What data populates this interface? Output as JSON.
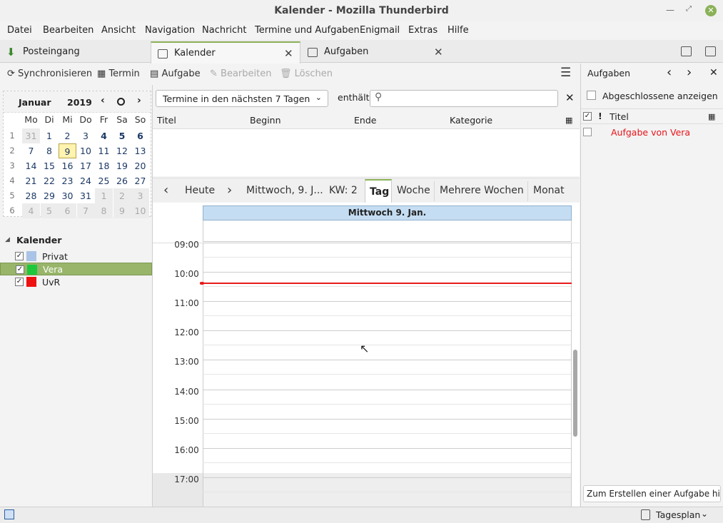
{
  "window": {
    "title": "Kalender - Mozilla Thunderbird"
  },
  "menu": [
    "Datei",
    "Bearbeiten",
    "Ansicht",
    "Navigation",
    "Nachricht",
    "Termine und Aufgaben",
    "Enigmail",
    "Extras",
    "Hilfe"
  ],
  "tabs": [
    "Posteingang",
    "Kalender",
    "Aufgaben"
  ],
  "toolbar": {
    "sync": "Synchronisieren",
    "event": "Termin",
    "task": "Aufgabe",
    "edit": "Bearbeiten",
    "delete": "Löschen"
  },
  "minimonth": {
    "month": "Januar",
    "year": "2019",
    "dow": [
      "Mo",
      "Di",
      "Mi",
      "Do",
      "Fr",
      "Sa",
      "So"
    ],
    "weeks": [
      {
        "wk": "1",
        "days": [
          "31",
          "1",
          "2",
          "3",
          "4",
          "5",
          "6"
        ]
      },
      {
        "wk": "2",
        "days": [
          "7",
          "8",
          "9",
          "10",
          "11",
          "12",
          "13"
        ]
      },
      {
        "wk": "3",
        "days": [
          "14",
          "15",
          "16",
          "17",
          "18",
          "19",
          "20"
        ]
      },
      {
        "wk": "4",
        "days": [
          "21",
          "22",
          "23",
          "24",
          "25",
          "26",
          "27"
        ]
      },
      {
        "wk": "5",
        "days": [
          "28",
          "29",
          "30",
          "31",
          "1",
          "2",
          "3"
        ]
      },
      {
        "wk": "6",
        "days": [
          "4",
          "5",
          "6",
          "7",
          "8",
          "9",
          "10"
        ]
      }
    ]
  },
  "calendars": {
    "heading": "Kalender",
    "items": [
      {
        "name": "Privat",
        "color": "#a9c4e6",
        "checked": "✓"
      },
      {
        "name": "Vera",
        "color": "#1ec83c",
        "checked": "✓"
      },
      {
        "name": "UvR",
        "color": "#ee1111",
        "checked": "✓"
      }
    ]
  },
  "filter": {
    "select": "Termine in den nächsten 7 Tagen",
    "contains": "enthält",
    "search_value": ""
  },
  "event_columns": [
    "Titel",
    "Beginn",
    "Ende",
    "Kategorie"
  ],
  "nav": {
    "today": "Heute",
    "date": "Mittwoch, 9. J...",
    "week": "KW: 2",
    "views": [
      "Tag",
      "Woche",
      "Mehrere Wochen",
      "Monat"
    ]
  },
  "dayview": {
    "header": "Mittwoch 9. Jan.",
    "hours": [
      "09:00",
      "10:00",
      "11:00",
      "12:00",
      "13:00",
      "14:00",
      "15:00",
      "16:00",
      "17:00"
    ]
  },
  "tasks": {
    "title": "Aufgaben",
    "show_completed": "Abgeschlossene anzeigen",
    "col_title": "Titel",
    "items": [
      {
        "title": "Aufgabe von Vera",
        "color": "#e8131a"
      }
    ],
    "new_task_placeholder": "Zum Erstellen einer Aufgabe hier"
  },
  "status": {
    "agenda": "Tagesplan"
  }
}
